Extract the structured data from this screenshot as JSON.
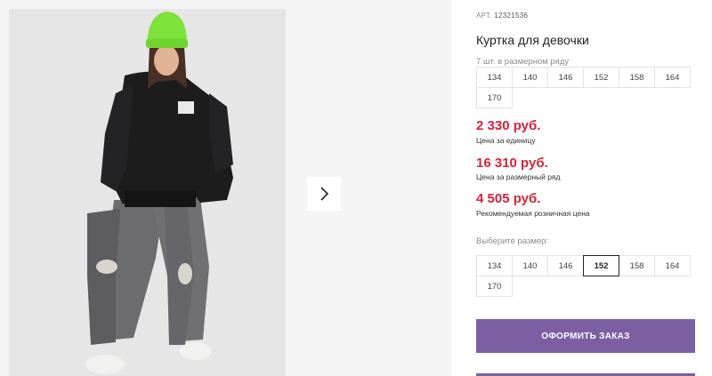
{
  "product": {
    "sku_label": "АРТ.",
    "sku_value": "12321536",
    "title": "Куртка для девочки"
  },
  "gallery": {
    "next_icon": "chevron-right-icon"
  },
  "pack": {
    "label": "7 шт. в размерном ряду",
    "sizes": [
      "134",
      "140",
      "146",
      "152",
      "158",
      "164",
      "170"
    ]
  },
  "prices": {
    "unit": {
      "value": "2 330 руб.",
      "caption": "Цена за единицу"
    },
    "pack": {
      "value": "16 310 руб.",
      "caption": "Цена за размерный ряд"
    },
    "retail": {
      "value": "4 505 руб.",
      "caption": "Рекомендуемая розничная цена"
    }
  },
  "size_select": {
    "label": "Выберите размер:",
    "sizes": [
      "134",
      "140",
      "146",
      "152",
      "158",
      "164",
      "170"
    ],
    "selected": "152"
  },
  "order_button": {
    "label": "ОФОРМИТЬ ЗАКАЗ"
  },
  "colors": {
    "accent": "#7c5fa3",
    "price": "#d6233a"
  }
}
